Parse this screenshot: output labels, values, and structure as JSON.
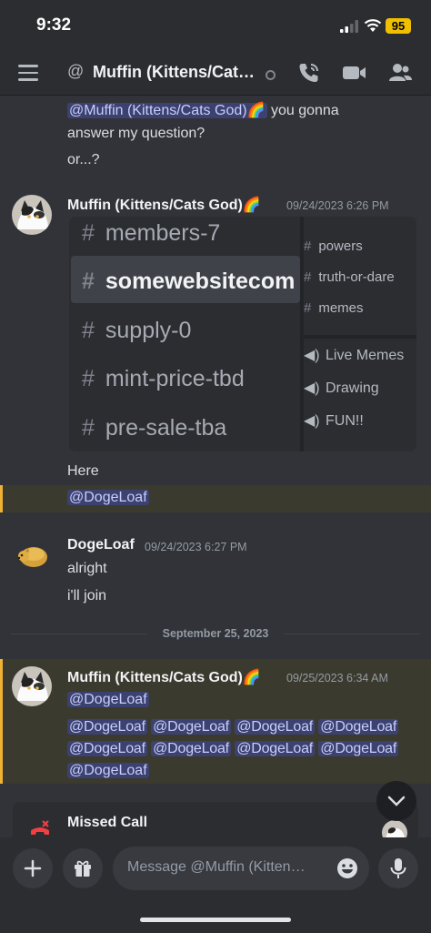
{
  "status_bar": {
    "time": "9:32",
    "battery": "95"
  },
  "header": {
    "title": "Muffin (Kittens/Cat…"
  },
  "messages": {
    "continuation": {
      "mention": "@Muffin (Kittens/Cats God)🌈",
      "line1_rest": " you gonna",
      "line2": "answer my question?",
      "line3": "or...?"
    },
    "m1": {
      "author": "Muffin (Kittens/Cats God)🌈",
      "timestamp": "09/24/2023 6:26 PM",
      "text": "Here",
      "mention": "@DogeLoaf"
    },
    "m2": {
      "author": "DogeLoaf",
      "timestamp": "09/24/2023 6:27 PM",
      "line1": "alright",
      "line2": "i'll join"
    },
    "date_divider": "September 25, 2023",
    "m3": {
      "author": "Muffin (Kittens/Cats God)🌈",
      "timestamp": "09/25/2023 6:34 AM",
      "mention": "@DogeLoaf"
    }
  },
  "embed_image": {
    "channels": [
      "members-7",
      "somewebsitecom",
      "supply-0",
      "mint-price-tbd",
      "pre-sale-tba"
    ],
    "text_channels_right": [
      "powers",
      "truth-or-dare",
      "memes"
    ],
    "voice_channels": [
      "Live Memes",
      "Drawing",
      "FUN!!"
    ]
  },
  "missed_call": {
    "label": "Missed Call"
  },
  "input": {
    "placeholder": "Message @Muffin (Kittens/..."
  }
}
